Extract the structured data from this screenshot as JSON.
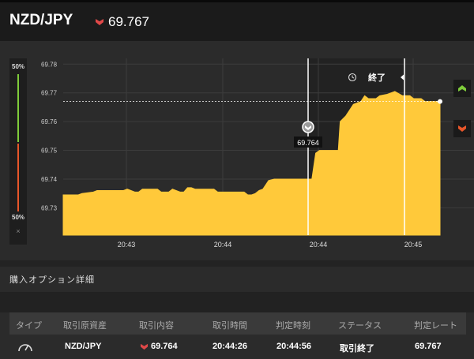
{
  "header": {
    "pair": "NZD/JPY",
    "rate": "69.767",
    "direction_color": "#e04848"
  },
  "chart_data": {
    "type": "area",
    "color": "#ffc93a",
    "y_ticks": [
      "69.78",
      "69.77",
      "69.76",
      "69.75",
      "69.74",
      "69.73"
    ],
    "x_ticks": [
      "20:43",
      "20:44",
      "20:44",
      "20:45"
    ],
    "ylim": [
      69.7205,
      69.782
    ],
    "current_rate": "69.767",
    "entry_marker": "69.764",
    "end_label": "終了",
    "series_points": [
      [
        0.0,
        69.7345
      ],
      [
        0.04,
        69.7345
      ],
      [
        0.05,
        69.735
      ],
      [
        0.08,
        69.7355
      ],
      [
        0.09,
        69.736
      ],
      [
        0.16,
        69.736
      ],
      [
        0.17,
        69.7365
      ],
      [
        0.19,
        69.7355
      ],
      [
        0.2,
        69.7355
      ],
      [
        0.21,
        69.7365
      ],
      [
        0.25,
        69.7365
      ],
      [
        0.26,
        69.7355
      ],
      [
        0.28,
        69.7355
      ],
      [
        0.29,
        69.7365
      ],
      [
        0.31,
        69.7355
      ],
      [
        0.32,
        69.7355
      ],
      [
        0.33,
        69.737
      ],
      [
        0.34,
        69.737
      ],
      [
        0.35,
        69.7365
      ],
      [
        0.4,
        69.7365
      ],
      [
        0.41,
        69.7355
      ],
      [
        0.48,
        69.7355
      ],
      [
        0.49,
        69.7345
      ],
      [
        0.5,
        69.7345
      ],
      [
        0.51,
        69.735
      ],
      [
        0.52,
        69.736
      ],
      [
        0.53,
        69.7365
      ],
      [
        0.545,
        69.7395
      ],
      [
        0.56,
        69.74
      ],
      [
        0.66,
        69.74
      ],
      [
        0.67,
        69.749
      ],
      [
        0.68,
        69.75
      ],
      [
        0.73,
        69.75
      ],
      [
        0.735,
        69.76
      ],
      [
        0.75,
        69.762
      ],
      [
        0.76,
        69.764
      ],
      [
        0.77,
        69.766
      ],
      [
        0.78,
        69.7665
      ],
      [
        0.79,
        69.767
      ],
      [
        0.8,
        69.769
      ],
      [
        0.81,
        69.768
      ],
      [
        0.83,
        69.768
      ],
      [
        0.84,
        69.769
      ],
      [
        0.86,
        69.7695
      ],
      [
        0.87,
        69.77
      ],
      [
        0.88,
        69.7705
      ],
      [
        0.9,
        69.769
      ],
      [
        0.92,
        69.769
      ],
      [
        0.93,
        69.768
      ],
      [
        0.95,
        69.768
      ],
      [
        0.96,
        69.767
      ],
      [
        0.98,
        69.767
      ],
      [
        1.0,
        69.767
      ]
    ]
  },
  "indicator": {
    "top": "50%",
    "bottom": "50%",
    "close": "×"
  },
  "details": {
    "title": "購入オプション詳細",
    "columns": [
      "タイプ",
      "取引原資産",
      "取引内容",
      "取引時間",
      "判定時刻",
      "ステータス",
      "判定レート"
    ],
    "row": {
      "asset": "NZD/JPY",
      "rate": "69.764",
      "trade_time": "20:44:26",
      "judge_time": "20:44:56",
      "status": "取引終了",
      "judge_rate": "69.767"
    }
  }
}
